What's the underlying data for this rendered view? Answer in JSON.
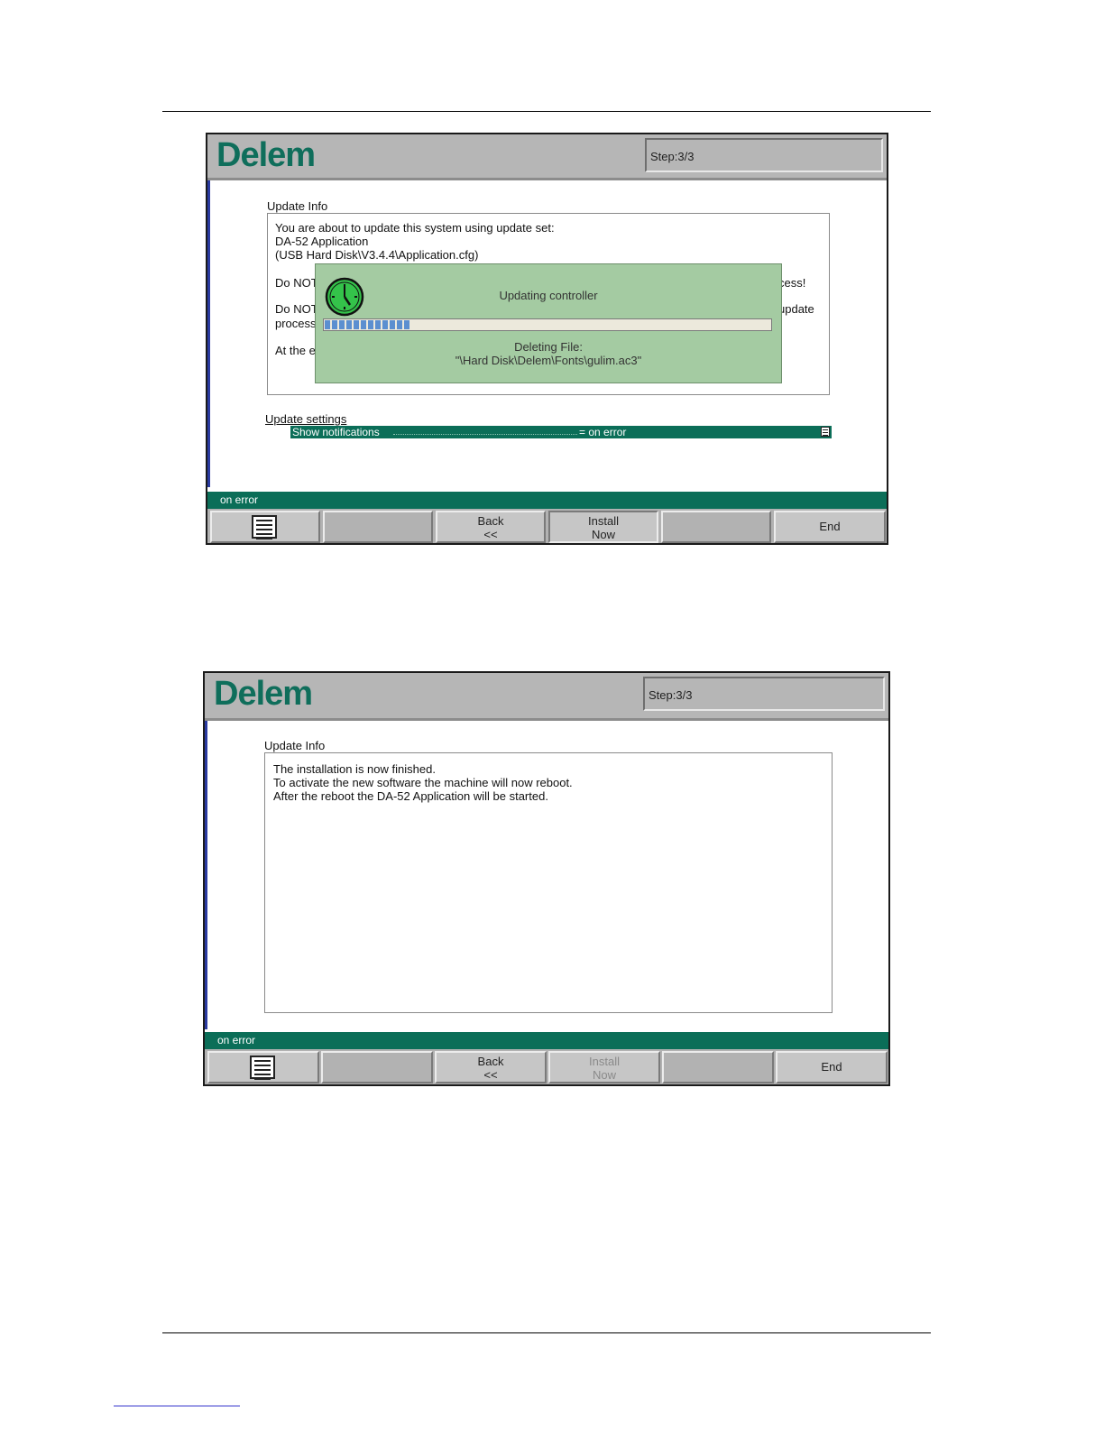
{
  "screen1": {
    "logo": "Delem",
    "step": "Step:3/3",
    "info_title": "Update Info",
    "info_lines": [
      "You are about to update this system using update set:",
      "DA-52 Application",
      "(USB Hard Disk\\V3.4.4\\Application.cfg)",
      "Do NOT",
      "cess!",
      "Do NOT",
      "update",
      "process",
      "At the e"
    ],
    "dialog": {
      "title": "Updating controller",
      "progress": 0.19,
      "status_label": "Deleting File:",
      "status_file": "\"\\Hard Disk\\Delem\\Fonts\\gulim.ac3\""
    },
    "settings_title": "Update settings",
    "setting": {
      "name": "Show notifications",
      "value": "= on error"
    },
    "status": "on error",
    "buttons": {
      "back": "Back",
      "back_sub": "<<",
      "install": "Install",
      "install_sub": "Now",
      "end": "End"
    }
  },
  "screen2": {
    "logo": "Delem",
    "step": "Step:3/3",
    "info_title": "Update Info",
    "info_lines": [
      "The installation is now finished.",
      "To activate the new software the machine will now reboot.",
      "After the reboot the DA-52 Application will be started."
    ],
    "status": "on error",
    "buttons": {
      "back": "Back",
      "back_sub": "<<",
      "install": "Install",
      "install_sub": "Now",
      "end": "End"
    }
  },
  "colors": {
    "brand_green": "#0f6e5b",
    "statusbar": "#0b6e58",
    "dialog_bg": "#a4cba2",
    "chrome_gray": "#b6b6b6"
  },
  "icons": [
    "clock-icon",
    "document-list-icon"
  ]
}
